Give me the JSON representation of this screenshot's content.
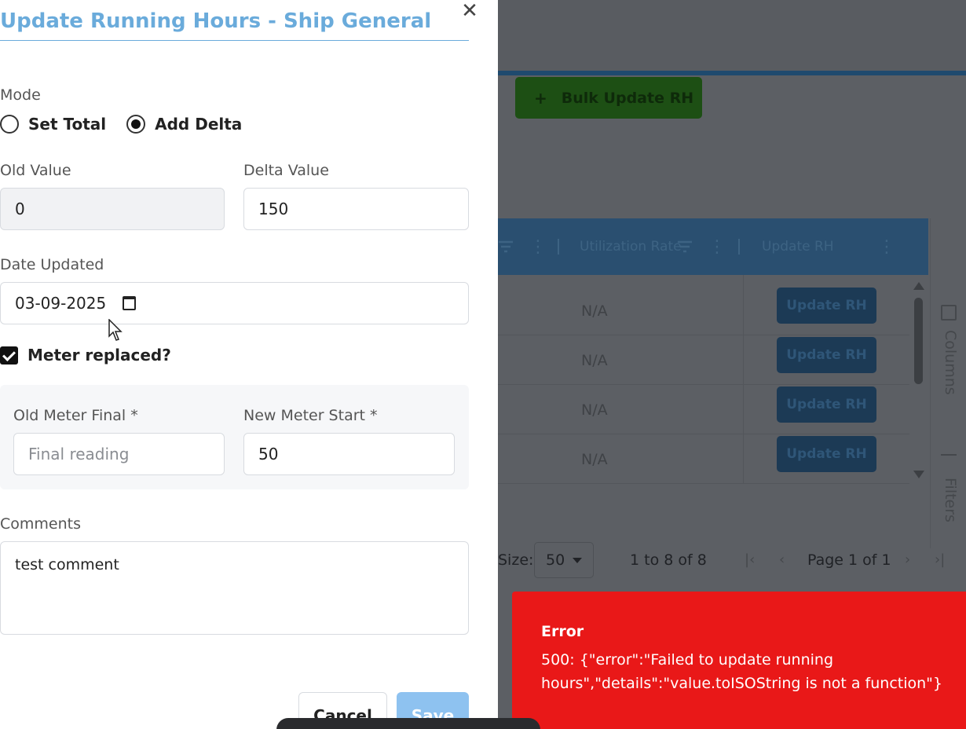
{
  "modal": {
    "title": "Update Running Hours - Ship General",
    "close_icon": "close-icon",
    "mode_label": "Mode",
    "mode_options": [
      {
        "label": "Set Total",
        "selected": false
      },
      {
        "label": "Add Delta",
        "selected": true
      }
    ],
    "old_value_label": "Old Value",
    "old_value": "0",
    "delta_value_label": "Delta Value",
    "delta_value": "150",
    "date_label": "Date Updated",
    "date_value": "03-09-2025",
    "meter_replaced_label": "Meter replaced?",
    "meter_replaced_checked": true,
    "old_meter_final_label": "Old Meter Final *",
    "old_meter_final_placeholder": "Final reading",
    "new_meter_start_label": "New Meter Start *",
    "new_meter_start_value": "50",
    "comments_label": "Comments",
    "comments_value": "test comment",
    "cancel_label": "Cancel",
    "save_label": "Save"
  },
  "background": {
    "bulk_button_label": "Bulk Update RH",
    "bulk_button_icon": "+",
    "grid_columns": [
      "Utilization Rate",
      "Update RH"
    ],
    "rows": [
      {
        "utilization": "N/A",
        "action": "Update RH"
      },
      {
        "utilization": "N/A",
        "action": "Update RH"
      },
      {
        "utilization": "N/A",
        "action": "Update RH"
      },
      {
        "utilization": "N/A",
        "action": "Update RH"
      }
    ],
    "side_panel": {
      "columns_label": "Columns",
      "filters_label": "Filters"
    },
    "pager": {
      "size_label": "Size:",
      "size_value": "50",
      "range_text": "1 to 8 of 8",
      "page_text": "Page 1 of 1"
    }
  },
  "toast": {
    "title": "Error",
    "message": "500: {\"error\":\"Failed to update running hours\",\"details\":\"value.toISOString is not a function\"}",
    "color": "#e91818"
  }
}
